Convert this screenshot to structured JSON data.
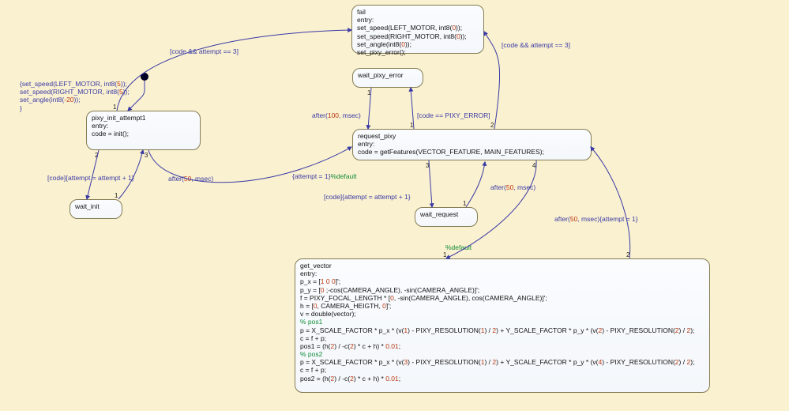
{
  "colors": {
    "blue": "#3a3aa6",
    "red": "#bb3710",
    "green": "#108b36"
  },
  "states": {
    "pixy_init_attempt1": {
      "title": "pixy_init_attempt1",
      "body": "entry:\ncode = init();"
    },
    "wait_init": {
      "title": "wait_init",
      "body": ""
    },
    "fail": {
      "title": "fail",
      "body_html": "entry:<br>set_speed(LEFT_MOTOR, int8(<span class='k-num'>0</span>));<br>set_speed(RIGHT_MOTOR, int8(<span class='k-num'>0</span>));<br>set_angle(int8(<span class='k-num'>0</span>));<br>set_pixy_error();"
    },
    "wait_pixy_error": {
      "title": "wait_pixy_error",
      "body": ""
    },
    "request_pixy": {
      "title": "request_pixy",
      "body": "entry:\ncode = getFeatures(VECTOR_FEATURE, MAIN_FEATURES);"
    },
    "wait_request": {
      "title": "wait_request",
      "body": ""
    },
    "get_vector": {
      "title": "get_vector",
      "body_html": "entry:<br>p_x = [<span class='k-num'>1</span> <span class='k-num'>0</span> <span class='k-num'>0</span>]';<br>p_y = [<span class='k-num'>0</span> ;-cos(CAMERA_ANGLE), -sin(CAMERA_ANGLE)]';<br>f = PIXY_FOCAL_LENGTH * [<span class='k-num'>0</span>, -sin(CAMERA_ANGLE), cos(CAMERA_ANGLE)]';<br>h = [<span class='k-num'>0</span>, CAMERA_HEIGTH, <span class='k-num'>0</span>]';<br>v = double(vector);<br><span class='k-cmt'>% pos1</span><br>p = X_SCALE_FACTOR * p_x * (v(<span class='k-num'>1</span>) - PIXY_RESOLUTION(<span class='k-num'>1</span>) / <span class='k-num'>2</span>) + Y_SCALE_FACTOR * p_y * (v(<span class='k-num'>2</span>) - PIXY_RESOLUTION(<span class='k-num'>2</span>) / <span class='k-num'>2</span>);<br>c = f + p;<br>pos1 = (h(<span class='k-num'>2</span>) / -c(<span class='k-num'>2</span>) * c + h) * <span class='k-num'>0.01</span>;<br><span class='k-cmt'>% pos2</span><br>p = X_SCALE_FACTOR * p_x * (v(<span class='k-num'>3</span>) - PIXY_RESOLUTION(<span class='k-num'>1</span>) / <span class='k-num'>2</span>) + Y_SCALE_FACTOR * p_y * (v(<span class='k-num'>4</span>) - PIXY_RESOLUTION(<span class='k-num'>2</span>) / <span class='k-num'>2</span>);<br>c = f + p;<br>pos2 = (h(<span class='k-num'>2</span>) / -c(<span class='k-num'>2</span>) * c + h) * <span class='k-num'>0.01</span>;"
    }
  },
  "entry_action_html": "{set_speed(LEFT_MOTOR, int8(<span class='k-num'>5</span>));<br>set_speed(RIGHT_MOTOR, int8(<span class='k-num'>5</span>));<br>set_angle(int8(<span class='k-num'>-20</span>));<br>}",
  "transitions": {
    "fail_left_cond": "[code && attempt == 3]",
    "fail_right_cond": "[code && attempt == 3]",
    "init_to_wait_cond": "[code]",
    "init_to_wait_act": "{attempt = attempt + 1}",
    "wait_to_init_html": "after(<span class='k-num'>50</span>, msec)",
    "wait_error_to_request_html": "after(<span class='k-num'>100</span>, msec)",
    "request_to_wait_error": "[code == PIXY_ERROR]",
    "init_to_request_act": "{attempt = 1}",
    "init_to_request_default": "%default",
    "request_to_wait_cond": "[code]",
    "request_to_wait_act": "{attempt = attempt + 1}",
    "wait_to_request_html": "after(<span class='k-num'>50</span>, msec)",
    "getvector_to_request_html": "after(<span class='k-num'>50</span>, msec)",
    "getvector_to_request_act": "{attempt = 1}",
    "request_to_getvector_default": "%default"
  },
  "priorities": {
    "init_1": "1",
    "init_2": "2",
    "init_3": "3",
    "wait_init_1": "1",
    "fail_entry": " ",
    "wpe_1": "1",
    "request_1": "1",
    "request_2": "2",
    "request_3": "3",
    "request_4": "4",
    "wait_req_1": "1",
    "getvector_1": "1",
    "getvector_2": "2"
  }
}
